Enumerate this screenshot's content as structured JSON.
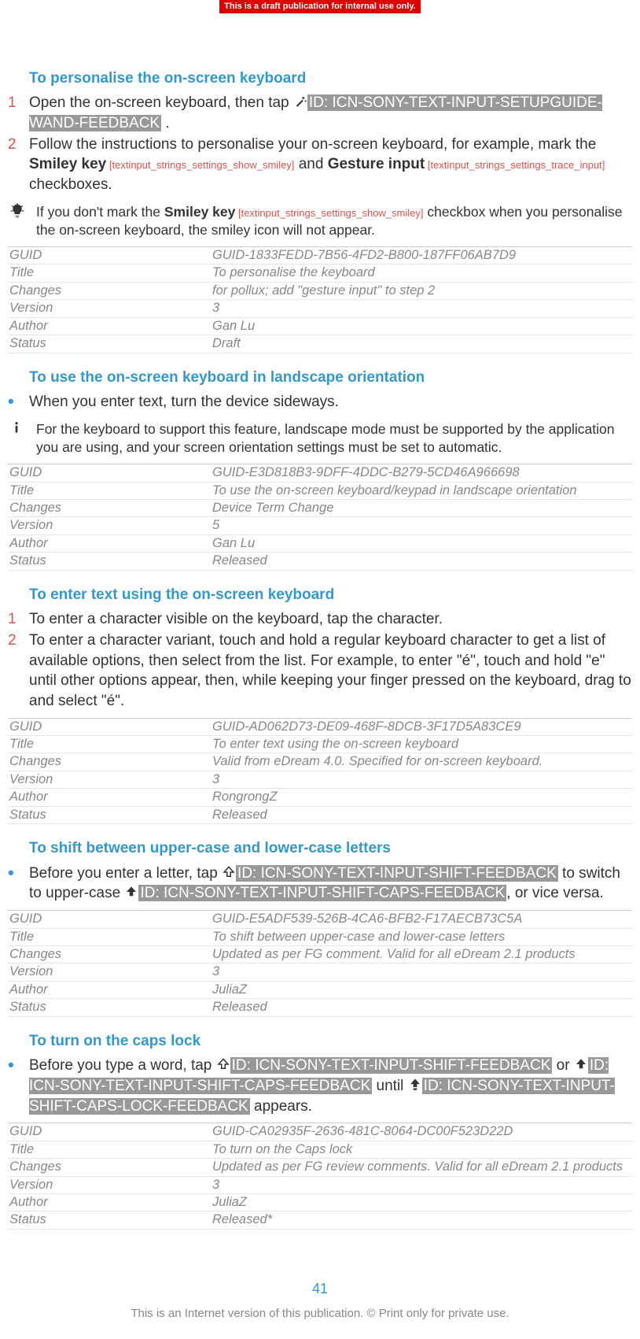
{
  "banner": "This is a draft publication for internal use only.",
  "page_number": "41",
  "footer": "This is an Internet version of this publication. © Print only for private use.",
  "sections": [
    {
      "title": "To personalise the on-screen keyboard",
      "steps": [
        {
          "n": "1",
          "pre": "Open the on-screen keyboard, then tap ",
          "hl": "ID: ICN-SONY-TEXT-INPUT-SETUPGUIDE-WAND-FEEDBACK",
          "post": " ."
        },
        {
          "n": "2",
          "pre": "Follow the instructions to personalise your on-screen keyboard, for example, mark the ",
          "b1": "Smiley key",
          "ref1": " [textinput_strings_settings_show_smiley]",
          "mid": " and ",
          "b2": "Gesture input",
          "ref2": " [textinput_strings_settings_trace_input]",
          "post": " checkboxes."
        }
      ],
      "tip": {
        "pre": "If you don't mark the ",
        "b1": "Smiley key",
        "ref1": " [textinput_strings_settings_show_smiley]",
        "post": " checkbox when you personalise the on-screen keyboard, the smiley icon will not appear."
      },
      "meta": {
        "GUID": "GUID-1833FEDD-7B56-4FD2-B800-187FF06AB7D9",
        "Title": "To personalise the keyboard",
        "Changes": "for pollux; add \"gesture input\" to step 2",
        "Version": "3",
        "Author": "Gan Lu",
        "Status": "Draft"
      }
    },
    {
      "title": "To use the on-screen keyboard in landscape orientation",
      "bullets": [
        {
          "text": "When you enter text, turn the device sideways."
        }
      ],
      "warn": {
        "text": "For the keyboard to support this feature, landscape mode must be supported by the application you are using, and your screen orientation settings must be set to automatic."
      },
      "meta": {
        "GUID": "GUID-E3D818B3-9DFF-4DDC-B279-5CD46A966698",
        "Title": "To use the on-screen keyboard/keypad in landscape orientation",
        "Changes": "Device Term Change",
        "Version": "5",
        "Author": "Gan Lu",
        "Status": "Released"
      }
    },
    {
      "title": "To enter text using the on-screen keyboard",
      "steps2": [
        {
          "n": "1",
          "text": "To enter a character visible on the keyboard, tap the character."
        },
        {
          "n": "2",
          "text": "To enter a character variant, touch and hold a regular keyboard character to get a list of available options, then select from the list. For example, to enter \"é\", touch and hold \"e\" until other options appear, then, while keeping your finger pressed on the keyboard, drag to and select \"é\"."
        }
      ],
      "meta": {
        "GUID": "GUID-AD062D73-DE09-468F-8DCB-3F17D5A83CE9",
        "Title": "To enter text using the on-screen keyboard",
        "Changes": "Valid from eDream 4.0. Specified for on-screen keyboard.",
        "Version": "3",
        "Author": "RongrongZ",
        "Status": "Released"
      }
    },
    {
      "title": "To shift between upper-case and lower-case letters",
      "bullets3": [
        {
          "pre": "Before you enter a letter, tap ",
          "hl1": "ID: ICN-SONY-TEXT-INPUT-SHIFT-FEEDBACK",
          "mid": " to switch to upper-case ",
          "hl2": "ID: ICN-SONY-TEXT-INPUT-SHIFT-CAPS-FEEDBACK",
          "post": ", or vice versa."
        }
      ],
      "meta": {
        "GUID": "GUID-E5ADF539-526B-4CA6-BFB2-F17AECB73C5A",
        "Title": "To shift between upper-case and lower-case letters",
        "Changes": "Updated as per FG comment. Valid for all eDream 2.1 products",
        "Version": "3",
        "Author": "JuliaZ",
        "Status": "Released"
      }
    },
    {
      "title": "To turn on the caps lock",
      "bullets4": [
        {
          "pre": "Before you type a word, tap ",
          "hl1": "ID: ICN-SONY-TEXT-INPUT-SHIFT-FEEDBACK",
          "mid": " or ",
          "hl2": "ID: ICN-SONY-TEXT-INPUT-SHIFT-CAPS-FEEDBACK",
          "mid2": " until ",
          "hl3": "ID: ICN-SONY-TEXT-INPUT-SHIFT-CAPS-LOCK-FEEDBACK",
          "post": " appears."
        }
      ],
      "meta": {
        "GUID": "GUID-CA02935F-2636-481C-8064-DC00F523D22D",
        "Title": "To turn on the Caps lock",
        "Changes": "Updated as per FG review comments. Valid for all eDream 2.1 products",
        "Version": "3",
        "Author": "JuliaZ",
        "Status": "Released*"
      }
    }
  ],
  "meta_labels": {
    "GUID": "GUID",
    "Title": "Title",
    "Changes": "Changes",
    "Version": "Version",
    "Author": "Author",
    "Status": "Status"
  }
}
